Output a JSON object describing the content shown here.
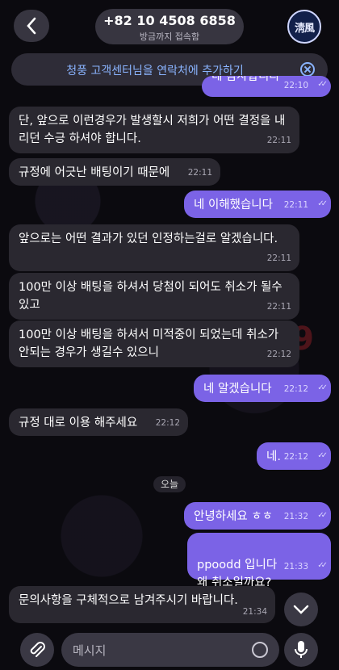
{
  "header": {
    "phone": "+82 10 4508 6858",
    "status": "방금까지 접속함",
    "avatar_text": "淸風"
  },
  "banner": {
    "text": "청풍 고객센터님을 연락처에 추가하기"
  },
  "partial_top": {
    "text": "네 감사합니다",
    "time": "22:10"
  },
  "messages": [
    {
      "dir": "in",
      "text": "단, 앞으로 이런경우가 발생할시 저희가 어떤 결정을 내리던 수긍 하셔야 합니다.",
      "time": "22:11"
    },
    {
      "dir": "in",
      "text": "규정에 어긋난 배팅이기 때문에",
      "time": "22:11"
    },
    {
      "dir": "out",
      "text": "네 이해했습니다",
      "time": "22:11"
    },
    {
      "dir": "in",
      "text": "앞으로는 어떤 결과가 있던 인정하는걸로 알겠습니다.",
      "time": "22:11"
    },
    {
      "dir": "in",
      "text": "100만 이상 배팅을 하셔서 당첨이 되어도 취소가 될수 있고",
      "time": "22:11"
    },
    {
      "dir": "in",
      "text": "100만 이상 배팅을 하셔서 미적중이 되었는데 취소가 안되는 경우가 생길수 있으니",
      "time": "22:12"
    },
    {
      "dir": "out",
      "text": "네 알겠습니다",
      "time": "22:12"
    },
    {
      "dir": "in",
      "text": "규정 대로 이용 해주세요",
      "time": "22:12"
    },
    {
      "dir": "out",
      "text": "네.",
      "time": "22:12"
    },
    {
      "dir": "out",
      "text": "안녕하세요 ㅎㅎ",
      "time": "21:32"
    },
    {
      "dir": "out",
      "text": "ppoodd 입니다\n왜 취소일까요?",
      "time": "21:33"
    },
    {
      "dir": "in",
      "text": "문의사항을 구체적으로 남겨주시기 바랍니다.",
      "time": "21:34"
    }
  ],
  "day_chip": "오늘",
  "watermark": "먹튀스팟9",
  "input": {
    "placeholder": "메시지"
  },
  "colors": {
    "outgoing": "#7b63e6",
    "incoming": "#2a2830",
    "link": "#8ab4ff"
  }
}
